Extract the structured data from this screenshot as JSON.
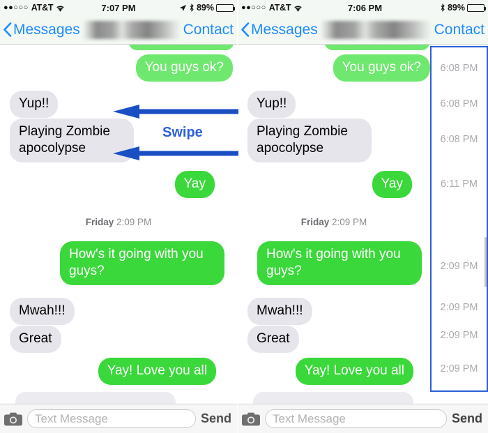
{
  "meta": {
    "app_name": "Messages",
    "accent_blue": "#1f8bff",
    "annotation_blue": "#2b5fd9",
    "bubble_out_green": "#3ad83a",
    "bubble_in_gray": "#e6e5eb",
    "timestamp_gray": "#a9a9ae"
  },
  "annotation": {
    "swipe_label": "Swipe",
    "arrow_direction": "left",
    "arrow_count": 2
  },
  "panels": [
    {
      "id": "left",
      "status_bar": {
        "signal_dots": "●●○○○",
        "carrier": "AT&T",
        "wifi_icon": "wifi-icon",
        "time": "7:07 PM",
        "location_icon": "location-arrow-icon",
        "bluetooth_icon": "bluetooth-icon",
        "battery_percent": "89%",
        "battery_level": 89
      },
      "nav_bar": {
        "back_icon": "chevron-left-icon",
        "back_label": "Messages",
        "title_redacted": true,
        "right_label": "Contact"
      },
      "messages": [
        {
          "text": "You guys ok?",
          "side": "out"
        },
        {
          "text": "Yup!!",
          "side": "in"
        },
        {
          "text": "Playing Zombie apocolypse",
          "side": "in"
        },
        {
          "text": "Yay",
          "side": "out"
        },
        {
          "text": "How's it going with you guys?",
          "side": "out"
        },
        {
          "text": "Mwah!!!",
          "side": "in"
        },
        {
          "text": "Great",
          "side": "in"
        },
        {
          "text": "Yay! Love you all",
          "side": "out"
        }
      ],
      "day_separator": {
        "day": "Friday",
        "time": "2:09 PM"
      },
      "timestamps_visible": false,
      "input_bar": {
        "camera_icon": "camera-icon",
        "placeholder": "Text Message",
        "value": "",
        "send_label": "Send"
      }
    },
    {
      "id": "right",
      "status_bar": {
        "signal_dots": "●●○○○",
        "carrier": "AT&T",
        "wifi_icon": "wifi-icon",
        "time": "7:06 PM",
        "bluetooth_icon": "bluetooth-icon",
        "battery_percent": "89%",
        "battery_level": 89
      },
      "nav_bar": {
        "back_icon": "chevron-left-icon",
        "back_label": "Messages",
        "title_redacted": true,
        "right_label": "Contact"
      },
      "messages": [
        {
          "text": "You guys ok?",
          "side": "out"
        },
        {
          "text": "Yup!!",
          "side": "in"
        },
        {
          "text": "Playing Zombie apocolypse",
          "side": "in"
        },
        {
          "text": "Yay",
          "side": "out"
        },
        {
          "text": "How's it going with you guys?",
          "side": "out"
        },
        {
          "text": "Mwah!!!",
          "side": "in"
        },
        {
          "text": "Great",
          "side": "in"
        },
        {
          "text": "Yay! Love you all",
          "side": "out"
        }
      ],
      "day_separator": {
        "day": "Friday",
        "time": "2:09 PM"
      },
      "timestamps_visible": true,
      "timestamps": [
        "6:08 PM",
        "6:08 PM",
        "6:08 PM",
        "6:11 PM",
        "2:09 PM",
        "2:09 PM",
        "2:09 PM",
        "2:09 PM"
      ],
      "input_bar": {
        "camera_icon": "camera-icon",
        "placeholder": "Text Message",
        "value": "",
        "send_label": "Send"
      }
    }
  ]
}
